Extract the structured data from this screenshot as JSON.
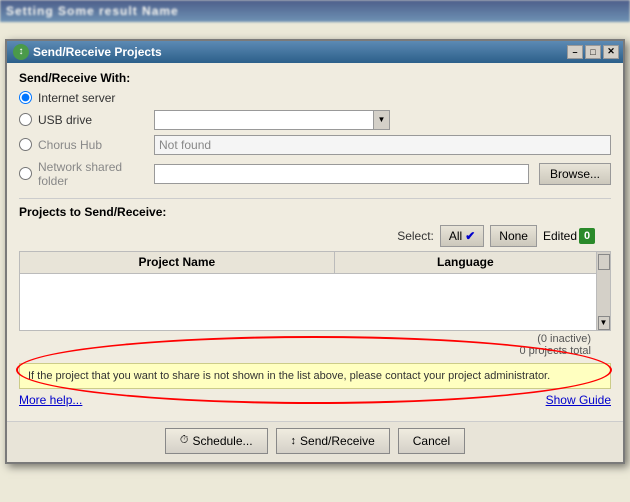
{
  "background": {
    "title": "Setting Some result Name"
  },
  "dialog": {
    "title": "Send/Receive Projects",
    "titlebar_controls": [
      "–",
      "□",
      "✕"
    ]
  },
  "send_receive_with": {
    "label": "Send/Receive With:",
    "options": [
      {
        "id": "internet",
        "label": "Internet server",
        "selected": true,
        "disabled": false,
        "field": null
      },
      {
        "id": "usb",
        "label": "USB drive",
        "selected": false,
        "disabled": false,
        "field": ""
      },
      {
        "id": "chorus",
        "label": "Chorus Hub",
        "selected": false,
        "disabled": false,
        "field": "Not found"
      },
      {
        "id": "network",
        "label": "Network shared folder",
        "selected": false,
        "disabled": false,
        "field": ""
      }
    ],
    "browse_label": "Browse..."
  },
  "projects": {
    "label": "Projects to Send/Receive:",
    "select_label": "Select:",
    "all_label": "All",
    "none_label": "None",
    "edited_label": "Edited",
    "edited_count": "0",
    "table": {
      "columns": [
        "Project Name",
        "Language"
      ],
      "rows": []
    },
    "inactive_info": "(0 inactive)",
    "total_info": "0 projects total"
  },
  "info_box": {
    "message": "If the project that you want to share is not shown in the list above, please contact your project administrator."
  },
  "help": {
    "more_help_label": "More help...",
    "show_guide_label": "Show Guide"
  },
  "buttons": {
    "schedule_label": "Schedule...",
    "send_receive_label": "Send/Receive",
    "cancel_label": "Cancel"
  }
}
